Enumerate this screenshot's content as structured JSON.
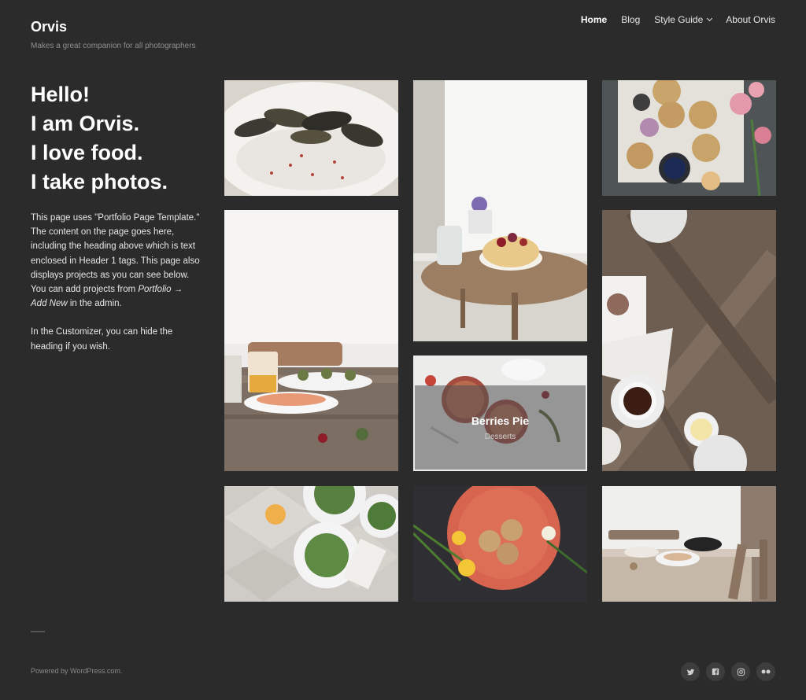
{
  "site": {
    "title": "Orvis",
    "tagline": "Makes a great companion for all photographers"
  },
  "nav": {
    "items": [
      {
        "label": "Home",
        "current": true
      },
      {
        "label": "Blog"
      },
      {
        "label": "Style Guide",
        "has_submenu": true
      },
      {
        "label": "About Orvis"
      }
    ]
  },
  "intro": {
    "heading_lines": [
      "Hello!",
      "I am Orvis.",
      "I love food.",
      "I take photos."
    ],
    "paragraph1_part1": "This page uses \"Portfolio Page Template.\" The content on the page goes here, including the heading above which is text enclosed in Header 1 tags. This page also displays projects as you can see below. You can add projects from ",
    "paragraph1_link": "Portfolio → Add New",
    "paragraph1_part2": " in the admin.",
    "paragraph2": "In the Customizer, you can hide the heading if you wish."
  },
  "portfolio": {
    "featured": {
      "title": "Berries Pie",
      "category": "Desserts"
    },
    "tiles": [
      {
        "name": "oysters-photo"
      },
      {
        "name": "fruit-bowl-table-photo"
      },
      {
        "name": "muffins-flowers-photo"
      },
      {
        "name": "breakfast-table-photo"
      },
      {
        "name": "berries-pie-photo"
      },
      {
        "name": "wood-table-coffee-photo"
      },
      {
        "name": "salad-plates-photo"
      },
      {
        "name": "cookies-plate-photo"
      },
      {
        "name": "rustic-dining-photo"
      }
    ]
  },
  "footer": {
    "powered_by": "Powered by WordPress.com.",
    "social_icons": [
      "twitter-icon",
      "facebook-icon",
      "instagram-icon",
      "flickr-icon"
    ]
  },
  "colors": {
    "background": "#2b2b2b",
    "text": "#ffffff",
    "muted": "#8f8f8f"
  }
}
